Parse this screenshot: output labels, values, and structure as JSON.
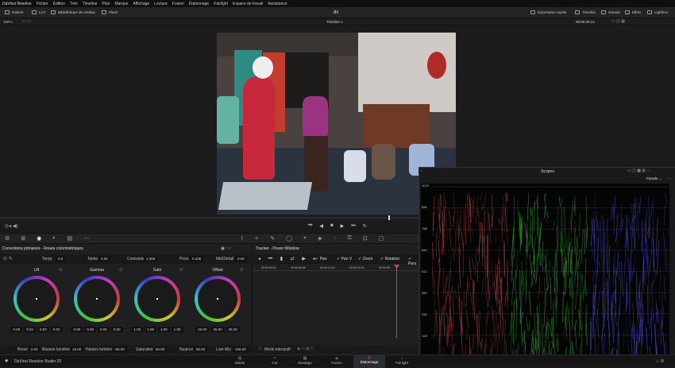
{
  "menubar": {
    "items": [
      "DaVinci Resolve",
      "Fichier",
      "Édition",
      "Trim",
      "Timeline",
      "Plan",
      "Marque",
      "Affichage",
      "Lecture",
      "Fusion",
      "Étalonnage",
      "Fairlight",
      "Espace de travail",
      "Assistance"
    ]
  },
  "toolbar": {
    "gallery": "Galerie",
    "lut": "LUT",
    "media_lib": "Bibliothèque de médias",
    "clips": "Plans",
    "project": "dv",
    "export": "Exportation rapide",
    "timeline": "Timeline",
    "nodes": "Nœuds",
    "effects": "Effets",
    "lightbox": "Lightbox"
  },
  "subbar": {
    "zoom": "180%",
    "timeline_name": "Timeline 1",
    "timecode": "00:00:29:14"
  },
  "primaries": {
    "title": "Corrections primaires - Roues colorimétriques",
    "temp_label": "Temp",
    "temp": "0.0",
    "tint_label": "Teinte",
    "tint": "0.00",
    "contrast_label": "Contraste",
    "contrast": "1.000",
    "pivot_label": "Pivot",
    "pivot": "0.435",
    "middetail_label": "Mid/Détail",
    "middetail": "0.00"
  },
  "wheels": [
    {
      "name": "Lift",
      "values": [
        "0.00",
        "0.02",
        "0.02",
        "0.02"
      ]
    },
    {
      "name": "Gamma",
      "values": [
        "0.00",
        "0.00",
        "0.00",
        "0.00"
      ]
    },
    {
      "name": "Gain",
      "values": [
        "1.00",
        "1.00",
        "1.00",
        "1.00"
      ]
    },
    {
      "name": "Offset",
      "values": [
        "25.00",
        "25.00",
        "25.00"
      ]
    }
  ],
  "bottom_params": {
    "boost_label": "Boost",
    "boost": "0.00",
    "shadows_label": "Basses lumières",
    "shadows": "16.00",
    "highlights_label": "Hautes lumières",
    "highlights": "-50.00",
    "saturation_label": "Saturation",
    "saturation": "50.00",
    "hue_label": "Nuance",
    "hue": "50.00",
    "lummix_label": "Lum Mix",
    "lummix": "100.00"
  },
  "tracker": {
    "title": "Tracker - Power Window",
    "options": [
      "Pan",
      "Pan V",
      "Zoom",
      "Rotation",
      "Pers"
    ],
    "timecodes": [
      "00:00:00:00",
      "00:00:06:08",
      "00:00:12:16",
      "00:00:19:23",
      "00:00:25:"
    ],
    "mode": "Mode interactif"
  },
  "scopes": {
    "title": "Scopes",
    "mode": "Parade",
    "labels": [
      "1023",
      "896",
      "768",
      "640",
      "512",
      "384",
      "256",
      "128",
      "0"
    ],
    "colors": {
      "r": "#e05050",
      "g": "#3fd03f",
      "b": "#5a5aff"
    }
  },
  "nav": {
    "app": "DaVinci Resolve Studio 20",
    "pages": [
      "Média",
      "Cut",
      "Montage",
      "Fusion",
      "Étalonnage",
      "Fairlight"
    ],
    "active": "Étalonnage"
  }
}
